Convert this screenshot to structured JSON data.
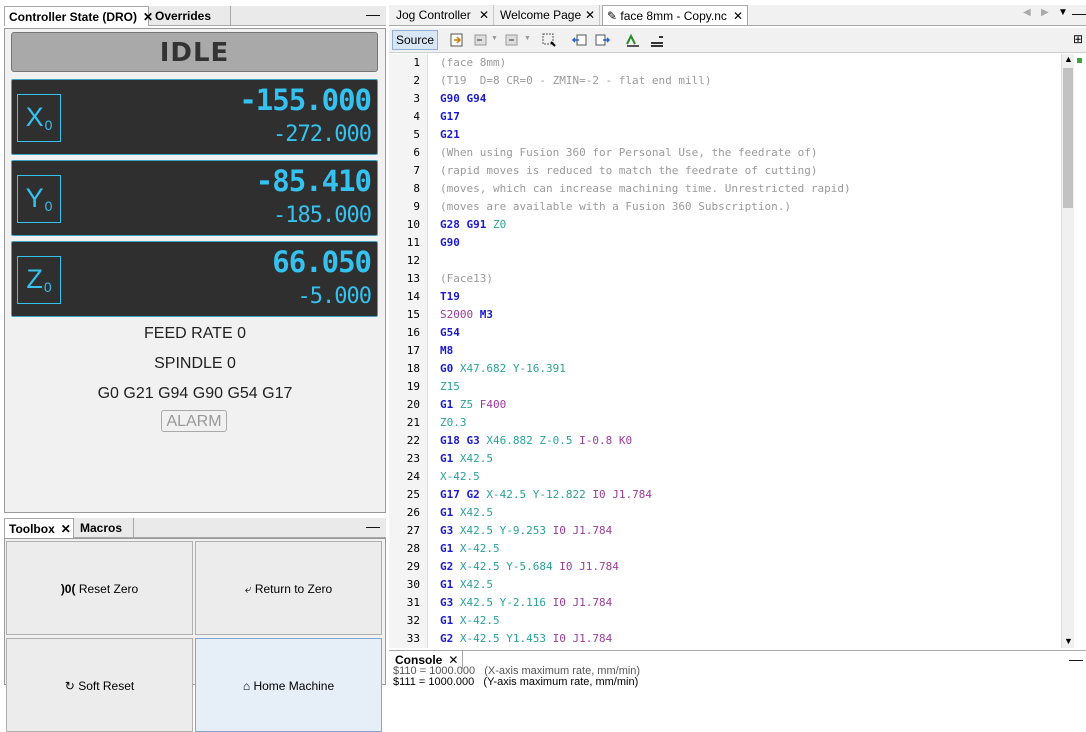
{
  "left_tabs": {
    "tab1": "Controller State (DRO)",
    "tab2": "Overrides"
  },
  "dro": {
    "state": "IDLE",
    "axes": [
      {
        "label": "X",
        "sub": "0",
        "work": "-155.000",
        "machine": "-272.000"
      },
      {
        "label": "Y",
        "sub": "0",
        "work": "-85.410",
        "machine": "-185.000"
      },
      {
        "label": "Z",
        "sub": "0",
        "work": "66.050",
        "machine": "-5.000"
      }
    ],
    "feed_rate": "FEED RATE 0",
    "spindle": "SPINDLE 0",
    "gcodes": "G0 G21 G94 G90 G54 G17",
    "alarm": "ALARM"
  },
  "toolbox_tabs": {
    "tab1": "Toolbox",
    "tab2": "Macros"
  },
  "toolbox": {
    "reset_zero": "Reset Zero",
    "return_to_zero": "Return to Zero",
    "soft_reset": "Soft Reset",
    "home_machine": "Home Machine"
  },
  "editor_tabs": {
    "tab1": "Jog Controller",
    "tab2": "Welcome Page",
    "tab3": "face 8mm - Copy.nc"
  },
  "editor": {
    "source_label": "Source",
    "lines": [
      "(face 8mm)",
      "(T19  D=8 CR=0 - ZMIN=-2 - flat end mill)",
      "G90 G94",
      "G17",
      "G21",
      "(When using Fusion 360 for Personal Use, the feedrate of)",
      "(rapid moves is reduced to match the feedrate of cutting)",
      "(moves, which can increase machining time. Unrestricted rapid)",
      "(moves are available with a Fusion 360 Subscription.)",
      "G28 G91 Z0",
      "G90",
      "",
      "(Face13)",
      "T19",
      "S2000 M3",
      "G54",
      "M8",
      "G0 X47.682 Y-16.391",
      "Z15",
      "G1 Z5 F400",
      "Z0.3",
      "G18 G3 X46.882 Z-0.5 I-0.8 K0",
      "G1 X42.5",
      "X-42.5",
      "G17 G2 X-42.5 Y-12.822 I0 J1.784",
      "G1 X42.5",
      "G3 X42.5 Y-9.253 I0 J1.784",
      "G1 X-42.5",
      "G2 X-42.5 Y-5.684 I0 J1.784",
      "G1 X42.5",
      "G3 X42.5 Y-2.116 I0 J1.784",
      "G1 X-42.5",
      "G2 X-42.5 Y1.453 I0 J1.784"
    ]
  },
  "console": {
    "tab": "Console",
    "line1": "$110 = 1000.000   (X-axis maximum rate, mm/min)",
    "line2": "$111 = 1000.000   (Y-axis maximum rate, mm/min)"
  }
}
